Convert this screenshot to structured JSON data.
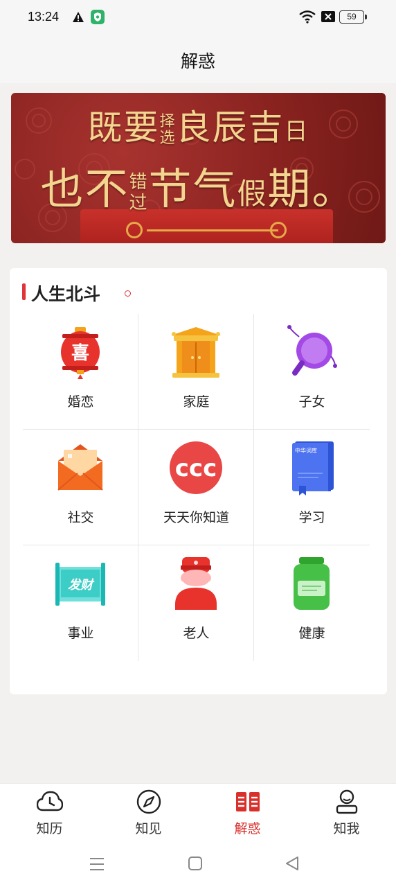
{
  "status": {
    "time": "13:24",
    "battery": "59",
    "icons": [
      "warning-icon",
      "shield-icon",
      "wifi-icon",
      "sim-x-icon",
      "battery-icon"
    ]
  },
  "header": {
    "title": "解惑"
  },
  "banner": {
    "line1_a": "既要",
    "line1_b_top": "择",
    "line1_b_bottom": "选",
    "line1_c": "良辰吉",
    "line1_d": "日",
    "line2_a": "也不",
    "line2_b_top": "错",
    "line2_b_bottom": "过",
    "line2_c": "节气",
    "line2_d": "假",
    "line2_e": "期。",
    "colors": {
      "bg": "#8a2320",
      "text": "#f3d58f"
    }
  },
  "section": {
    "title": "人生北斗",
    "accent": "#e0333a",
    "items": [
      {
        "label": "婚恋",
        "icon": "lantern-icon"
      },
      {
        "label": "家庭",
        "icon": "house-gate-icon"
      },
      {
        "label": "子女",
        "icon": "magnifier-icon"
      },
      {
        "label": "社交",
        "icon": "envelope-icon"
      },
      {
        "label": "天天你知道",
        "icon": "quote-icon"
      },
      {
        "label": "学习",
        "icon": "book-icon"
      },
      {
        "label": "事业",
        "icon": "scroll-icon"
      },
      {
        "label": "老人",
        "icon": "elder-icon"
      },
      {
        "label": "健康",
        "icon": "jar-icon"
      }
    ],
    "book_text": "中华词库",
    "scroll_text": "发财",
    "lantern_text": "喜",
    "quote_text": "ccc"
  },
  "bottom_nav": {
    "items": [
      {
        "label": "知历",
        "icon": "clock-icon",
        "active": false
      },
      {
        "label": "知见",
        "icon": "compass-icon",
        "active": false
      },
      {
        "label": "解惑",
        "icon": "open-book-icon",
        "active": true
      },
      {
        "label": "知我",
        "icon": "profile-icon",
        "active": false
      }
    ],
    "active_color": "#d9302c"
  }
}
